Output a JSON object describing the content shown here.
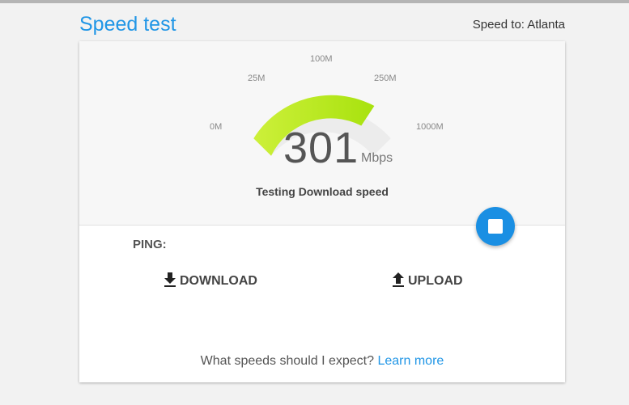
{
  "header": {
    "title": "Speed test",
    "speed_to": "Speed to: Atlanta"
  },
  "gauge": {
    "ticks": [
      "0M",
      "25M",
      "100M",
      "250M",
      "1000M"
    ],
    "value": "301",
    "unit": "Mbps",
    "status": "Testing Download speed",
    "fill_color": "#b9e82a",
    "track_color": "#ececec"
  },
  "controls": {
    "stop_icon": "stop-icon"
  },
  "results": {
    "ping_label": "PING:",
    "download_label": "DOWNLOAD",
    "upload_label": "UPLOAD"
  },
  "footer": {
    "question": "What speeds should I expect?",
    "link": "Learn more"
  },
  "colors": {
    "accent": "#2196e6",
    "stop_button": "#1a8fe3"
  }
}
